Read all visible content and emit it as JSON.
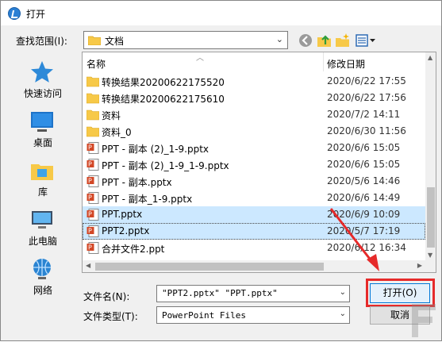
{
  "window": {
    "title": "打开"
  },
  "toolbar": {
    "look_in_label": "查找范围(I):",
    "look_in_value": "文档"
  },
  "places": [
    {
      "label": "快速访问",
      "icon": "star-icon"
    },
    {
      "label": "桌面",
      "icon": "desktop-icon"
    },
    {
      "label": "库",
      "icon": "library-icon"
    },
    {
      "label": "此电脑",
      "icon": "computer-icon"
    },
    {
      "label": "网络",
      "icon": "network-icon"
    }
  ],
  "columns": {
    "name": "名称",
    "date": "修改日期"
  },
  "files": [
    {
      "name": "转换结果20200622175520",
      "date": "2020/6/22 17:55",
      "type": "folder",
      "selected": false
    },
    {
      "name": "转换结果20200622175610",
      "date": "2020/6/22 17:56",
      "type": "folder",
      "selected": false
    },
    {
      "name": "资料",
      "date": "2020/7/2 14:11",
      "type": "folder",
      "selected": false
    },
    {
      "name": "资料_0",
      "date": "2020/6/30 11:56",
      "type": "folder",
      "selected": false
    },
    {
      "name": "PPT - 副本 (2)_1-9.pptx",
      "date": "2020/6/6 15:05",
      "type": "ppt",
      "selected": false
    },
    {
      "name": "PPT - 副本 (2)_1-9_1-9.pptx",
      "date": "2020/6/6 15:05",
      "type": "ppt",
      "selected": false
    },
    {
      "name": "PPT - 副本.pptx",
      "date": "2020/5/6 14:46",
      "type": "ppt",
      "selected": false
    },
    {
      "name": "PPT - 副本_1-9.pptx",
      "date": "2020/6/6 14:49",
      "type": "ppt",
      "selected": false
    },
    {
      "name": "PPT.pptx",
      "date": "2020/6/9 10:09",
      "type": "ppt",
      "selected": true
    },
    {
      "name": "PPT2.pptx",
      "date": "2020/5/7 17:19",
      "type": "ppt",
      "selected": true
    },
    {
      "name": "合并文件2.ppt",
      "date": "2020/6/12 16:34",
      "type": "ppt",
      "selected": false
    }
  ],
  "form": {
    "filename_label": "文件名(N):",
    "filename_value": "\"PPT2.pptx\" \"PPT.pptx\"",
    "filetype_label": "文件类型(T):",
    "filetype_value": "PowerPoint Files",
    "open_label": "打开(O)",
    "cancel_label": "取消"
  },
  "colors": {
    "accent": "#0078d7",
    "selection": "#cce8ff",
    "annotation": "#e62a2a",
    "folder": "#f7c948",
    "ppt": "#d24726"
  }
}
